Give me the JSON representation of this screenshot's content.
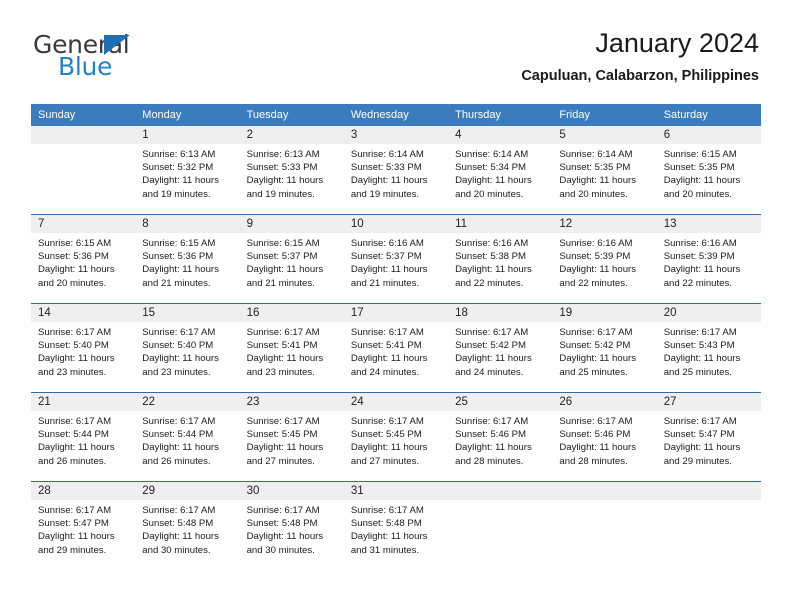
{
  "brand": {
    "name_top": "General",
    "name_bottom": "Blue",
    "triangle_color": "#1f6fb5",
    "blue_text_color": "#2383c4"
  },
  "header": {
    "title": "January 2024",
    "subtitle": "Capuluan, Calabarzon, Philippines"
  },
  "theme": {
    "header_row_bg": "#3a7cbe",
    "header_row_text": "#ffffff",
    "daynum_band_bg": "#efefef",
    "week_divider": "#2e6da4"
  },
  "weekday_headers": [
    "Sunday",
    "Monday",
    "Tuesday",
    "Wednesday",
    "Thursday",
    "Friday",
    "Saturday"
  ],
  "labels": {
    "sunrise_prefix": "Sunrise:",
    "sunset_prefix": "Sunset:",
    "daylight_prefix": "Daylight:"
  },
  "weeks": [
    [
      {
        "day": "",
        "lines": []
      },
      {
        "day": "1",
        "lines": [
          "Sunrise: 6:13 AM",
          "Sunset: 5:32 PM",
          "Daylight: 11 hours",
          "and 19 minutes."
        ]
      },
      {
        "day": "2",
        "lines": [
          "Sunrise: 6:13 AM",
          "Sunset: 5:33 PM",
          "Daylight: 11 hours",
          "and 19 minutes."
        ]
      },
      {
        "day": "3",
        "lines": [
          "Sunrise: 6:14 AM",
          "Sunset: 5:33 PM",
          "Daylight: 11 hours",
          "and 19 minutes."
        ]
      },
      {
        "day": "4",
        "lines": [
          "Sunrise: 6:14 AM",
          "Sunset: 5:34 PM",
          "Daylight: 11 hours",
          "and 20 minutes."
        ]
      },
      {
        "day": "5",
        "lines": [
          "Sunrise: 6:14 AM",
          "Sunset: 5:35 PM",
          "Daylight: 11 hours",
          "and 20 minutes."
        ]
      },
      {
        "day": "6",
        "lines": [
          "Sunrise: 6:15 AM",
          "Sunset: 5:35 PM",
          "Daylight: 11 hours",
          "and 20 minutes."
        ]
      }
    ],
    [
      {
        "day": "7",
        "lines": [
          "Sunrise: 6:15 AM",
          "Sunset: 5:36 PM",
          "Daylight: 11 hours",
          "and 20 minutes."
        ]
      },
      {
        "day": "8",
        "lines": [
          "Sunrise: 6:15 AM",
          "Sunset: 5:36 PM",
          "Daylight: 11 hours",
          "and 21 minutes."
        ]
      },
      {
        "day": "9",
        "lines": [
          "Sunrise: 6:15 AM",
          "Sunset: 5:37 PM",
          "Daylight: 11 hours",
          "and 21 minutes."
        ]
      },
      {
        "day": "10",
        "lines": [
          "Sunrise: 6:16 AM",
          "Sunset: 5:37 PM",
          "Daylight: 11 hours",
          "and 21 minutes."
        ]
      },
      {
        "day": "11",
        "lines": [
          "Sunrise: 6:16 AM",
          "Sunset: 5:38 PM",
          "Daylight: 11 hours",
          "and 22 minutes."
        ]
      },
      {
        "day": "12",
        "lines": [
          "Sunrise: 6:16 AM",
          "Sunset: 5:39 PM",
          "Daylight: 11 hours",
          "and 22 minutes."
        ]
      },
      {
        "day": "13",
        "lines": [
          "Sunrise: 6:16 AM",
          "Sunset: 5:39 PM",
          "Daylight: 11 hours",
          "and 22 minutes."
        ]
      }
    ],
    [
      {
        "day": "14",
        "lines": [
          "Sunrise: 6:17 AM",
          "Sunset: 5:40 PM",
          "Daylight: 11 hours",
          "and 23 minutes."
        ]
      },
      {
        "day": "15",
        "lines": [
          "Sunrise: 6:17 AM",
          "Sunset: 5:40 PM",
          "Daylight: 11 hours",
          "and 23 minutes."
        ]
      },
      {
        "day": "16",
        "lines": [
          "Sunrise: 6:17 AM",
          "Sunset: 5:41 PM",
          "Daylight: 11 hours",
          "and 23 minutes."
        ]
      },
      {
        "day": "17",
        "lines": [
          "Sunrise: 6:17 AM",
          "Sunset: 5:41 PM",
          "Daylight: 11 hours",
          "and 24 minutes."
        ]
      },
      {
        "day": "18",
        "lines": [
          "Sunrise: 6:17 AM",
          "Sunset: 5:42 PM",
          "Daylight: 11 hours",
          "and 24 minutes."
        ]
      },
      {
        "day": "19",
        "lines": [
          "Sunrise: 6:17 AM",
          "Sunset: 5:42 PM",
          "Daylight: 11 hours",
          "and 25 minutes."
        ]
      },
      {
        "day": "20",
        "lines": [
          "Sunrise: 6:17 AM",
          "Sunset: 5:43 PM",
          "Daylight: 11 hours",
          "and 25 minutes."
        ]
      }
    ],
    [
      {
        "day": "21",
        "lines": [
          "Sunrise: 6:17 AM",
          "Sunset: 5:44 PM",
          "Daylight: 11 hours",
          "and 26 minutes."
        ]
      },
      {
        "day": "22",
        "lines": [
          "Sunrise: 6:17 AM",
          "Sunset: 5:44 PM",
          "Daylight: 11 hours",
          "and 26 minutes."
        ]
      },
      {
        "day": "23",
        "lines": [
          "Sunrise: 6:17 AM",
          "Sunset: 5:45 PM",
          "Daylight: 11 hours",
          "and 27 minutes."
        ]
      },
      {
        "day": "24",
        "lines": [
          "Sunrise: 6:17 AM",
          "Sunset: 5:45 PM",
          "Daylight: 11 hours",
          "and 27 minutes."
        ]
      },
      {
        "day": "25",
        "lines": [
          "Sunrise: 6:17 AM",
          "Sunset: 5:46 PM",
          "Daylight: 11 hours",
          "and 28 minutes."
        ]
      },
      {
        "day": "26",
        "lines": [
          "Sunrise: 6:17 AM",
          "Sunset: 5:46 PM",
          "Daylight: 11 hours",
          "and 28 minutes."
        ]
      },
      {
        "day": "27",
        "lines": [
          "Sunrise: 6:17 AM",
          "Sunset: 5:47 PM",
          "Daylight: 11 hours",
          "and 29 minutes."
        ]
      }
    ],
    [
      {
        "day": "28",
        "lines": [
          "Sunrise: 6:17 AM",
          "Sunset: 5:47 PM",
          "Daylight: 11 hours",
          "and 29 minutes."
        ]
      },
      {
        "day": "29",
        "lines": [
          "Sunrise: 6:17 AM",
          "Sunset: 5:48 PM",
          "Daylight: 11 hours",
          "and 30 minutes."
        ]
      },
      {
        "day": "30",
        "lines": [
          "Sunrise: 6:17 AM",
          "Sunset: 5:48 PM",
          "Daylight: 11 hours",
          "and 30 minutes."
        ]
      },
      {
        "day": "31",
        "lines": [
          "Sunrise: 6:17 AM",
          "Sunset: 5:48 PM",
          "Daylight: 11 hours",
          "and 31 minutes."
        ]
      },
      {
        "day": "",
        "lines": []
      },
      {
        "day": "",
        "lines": []
      },
      {
        "day": "",
        "lines": []
      }
    ]
  ]
}
